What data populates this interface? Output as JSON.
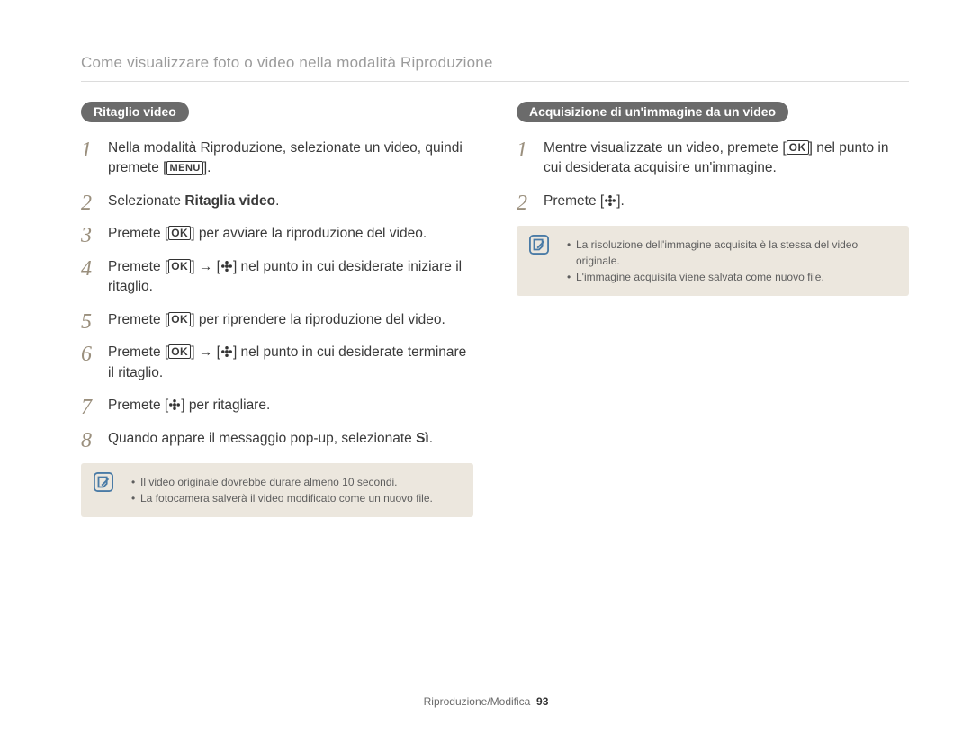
{
  "header": {
    "title": "Come visualizzare foto o video nella modalità Riproduzione"
  },
  "icons": {
    "ok": "OK",
    "menu": "MENU"
  },
  "left": {
    "heading": "Ritaglio video",
    "steps": {
      "s1a": "Nella modalità Riproduzione, selezionate un video, quindi premete [",
      "s1b": "].",
      "s2a": "Selezionate ",
      "s2b": "Ritaglia video",
      "s2c": ".",
      "s3a": "Premete [",
      "s3b": "] per avviare la riproduzione del video.",
      "s4a": "Premete [",
      "s4b": "] → [",
      "s4c": "] nel punto in cui desiderate iniziare il ritaglio.",
      "s5a": "Premete [",
      "s5b": "] per riprendere la riproduzione del video.",
      "s6a": "Premete [",
      "s6b": "] → [",
      "s6c": "] nel punto in cui desiderate terminare il ritaglio.",
      "s7a": "Premete [",
      "s7b": "] per ritagliare.",
      "s8a": "Quando appare il messaggio pop-up, selezionate ",
      "s8b": "Sì",
      "s8c": "."
    },
    "notes": {
      "n1": "Il video originale dovrebbe durare almeno 10 secondi.",
      "n2": "La fotocamera salverà il video modificato come un nuovo file."
    }
  },
  "right": {
    "heading": "Acquisizione di un'immagine da un video",
    "steps": {
      "s1a": "Mentre visualizzate un video, premete [",
      "s1b": "] nel punto in cui desiderata acquisire un'immagine.",
      "s2a": "Premete [",
      "s2b": "]."
    },
    "notes": {
      "n1": "La risoluzione dell'immagine acquisita è la stessa del video originale.",
      "n2": "L'immagine acquisita viene salvata come nuovo file."
    }
  },
  "footer": {
    "section": "Riproduzione/Modifica",
    "page": "93"
  }
}
